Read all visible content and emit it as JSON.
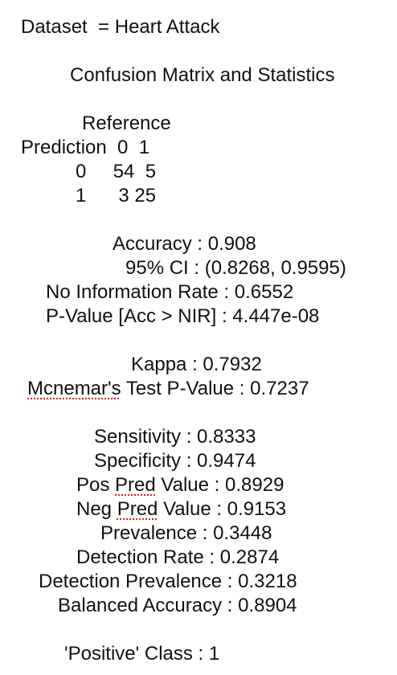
{
  "dataset_line": "Dataset  = Heart Attack",
  "title": "Confusion Matrix and Statistics",
  "matrix": {
    "reference_label": "Reference",
    "header_row": "Prediction  0  1",
    "row_0": "0     54  5",
    "row_1": "1      3 25"
  },
  "stats": {
    "accuracy": "Accuracy : 0.908",
    "ci": "95% CI : (0.8268, 0.9595)",
    "nir": "No Information Rate : 0.6552",
    "pvalue": "P-Value [Acc > NIR] : 4.447e-08",
    "kappa": "Kappa : 0.7932",
    "mcnemar_word": "Mcnemar's",
    "mcnemar_rest": " Test P-Value : 0.7237",
    "sensitivity": "Sensitivity : 0.8333",
    "specificity": "Specificity : 0.9474",
    "pos_pred_a": "Pos ",
    "pos_pred_word": "Pred",
    "pos_pred_b": " Value : 0.8929",
    "neg_pred_a": "Neg ",
    "neg_pred_word": "Pred",
    "neg_pred_b": " Value : 0.9153",
    "prevalence": "Prevalence : 0.3448",
    "detection_rate": "Detection Rate : 0.2874",
    "detection_prevalence": "Detection Prevalence : 0.3218",
    "balanced_accuracy": "Balanced Accuracy : 0.8904"
  },
  "positive_class": "'Positive' Class : 1",
  "colors": {
    "text": "#111111",
    "spellcheck_underline": "#e02020"
  }
}
